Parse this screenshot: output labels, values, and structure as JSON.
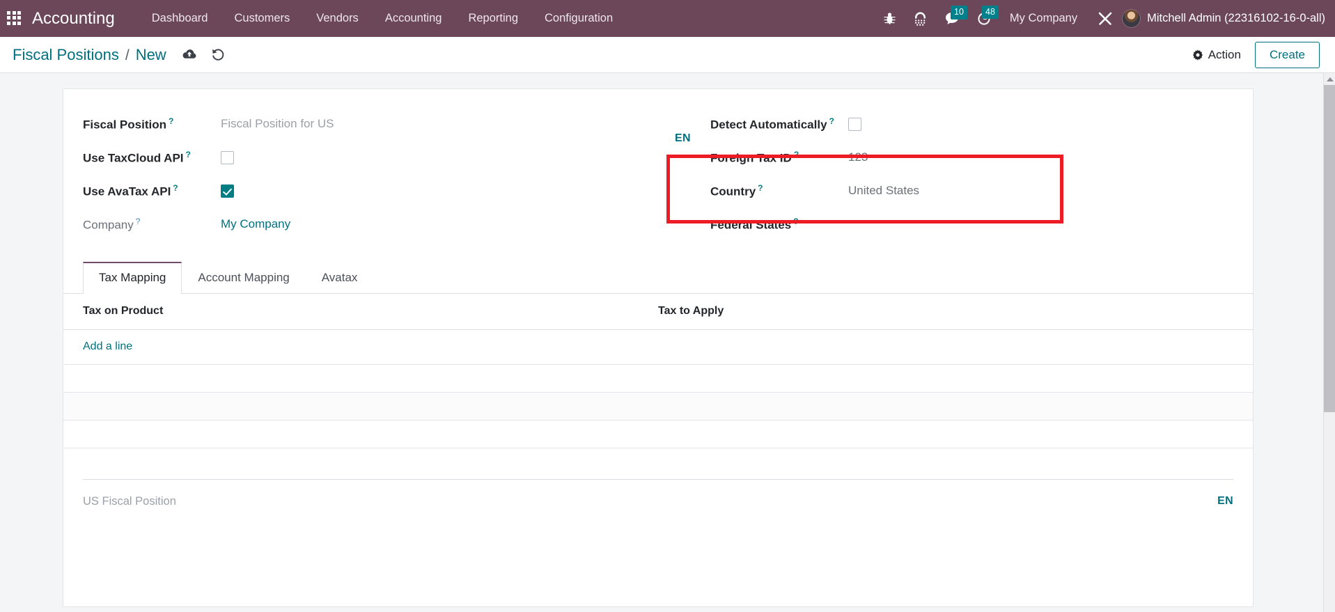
{
  "navbar": {
    "apps_icon": "apps-grid-icon",
    "brand": "Accounting",
    "menu": [
      {
        "label": "Dashboard"
      },
      {
        "label": "Customers"
      },
      {
        "label": "Vendors"
      },
      {
        "label": "Accounting"
      },
      {
        "label": "Reporting"
      },
      {
        "label": "Configuration"
      }
    ],
    "icons": [
      {
        "name": "bug-icon",
        "glyph": " "
      },
      {
        "name": "dialpad-icon",
        "glyph": " "
      }
    ],
    "messages": {
      "name": "messages-icon",
      "count": "10"
    },
    "activities": {
      "name": "activities-clock-icon",
      "count": "48"
    },
    "company": "My Company",
    "tools_icon": "wrench-screwdriver-icon",
    "user": "Mitchell Admin (22316102-16-0-all)",
    "accent_badge_color": "#00808a",
    "navbar_color": "#6b4759"
  },
  "control_panel": {
    "breadcrumb_parent": "Fiscal Positions",
    "breadcrumb_separator": "/",
    "breadcrumb_current": "New",
    "save_icon": "cloud-upload-save-icon",
    "discard_icon": "undo-discard-icon",
    "action_label": "Action",
    "action_icon": "gear-icon",
    "create_label": "Create",
    "accent_color": "#00707e"
  },
  "form": {
    "left": {
      "fiscal_position": {
        "label": "Fiscal Position",
        "value": "Fiscal Position for US",
        "help": "?"
      },
      "use_taxcloud": {
        "label": "Use TaxCloud API",
        "checked": false,
        "help": "?"
      },
      "use_avatax": {
        "label": "Use AvaTax API",
        "checked": true,
        "help": "?"
      },
      "company": {
        "label": "Company",
        "value": "My Company",
        "help": "?"
      },
      "lang_badge": "EN"
    },
    "right": {
      "detect_automatically": {
        "label": "Detect Automatically",
        "checked": false,
        "help": "?"
      },
      "foreign_tax_id": {
        "label": "Foreign Tax ID",
        "value": "123",
        "help": "?"
      },
      "country": {
        "label": "Country",
        "value": "United States",
        "help": "?"
      },
      "federal_states": {
        "label": "Federal States",
        "value": "",
        "help": "?"
      }
    }
  },
  "annotation": {
    "color": "#ed1c24",
    "target": "foreign-tax-id-and-country-fields"
  },
  "notebook": {
    "tabs": [
      {
        "label": "Tax Mapping",
        "active": true
      },
      {
        "label": "Account Mapping",
        "active": false
      },
      {
        "label": "Avatax",
        "active": false
      }
    ],
    "table": {
      "headers": [
        "Tax on Product",
        "Tax to Apply"
      ],
      "rows": [],
      "add_line_label": "Add a line",
      "empty_row_count": 3
    }
  },
  "notes": {
    "placeholder": "US Fiscal Position",
    "lang_badge": "EN"
  },
  "scrollbar": {
    "up_arrow": "scroll-up-arrow-icon"
  }
}
